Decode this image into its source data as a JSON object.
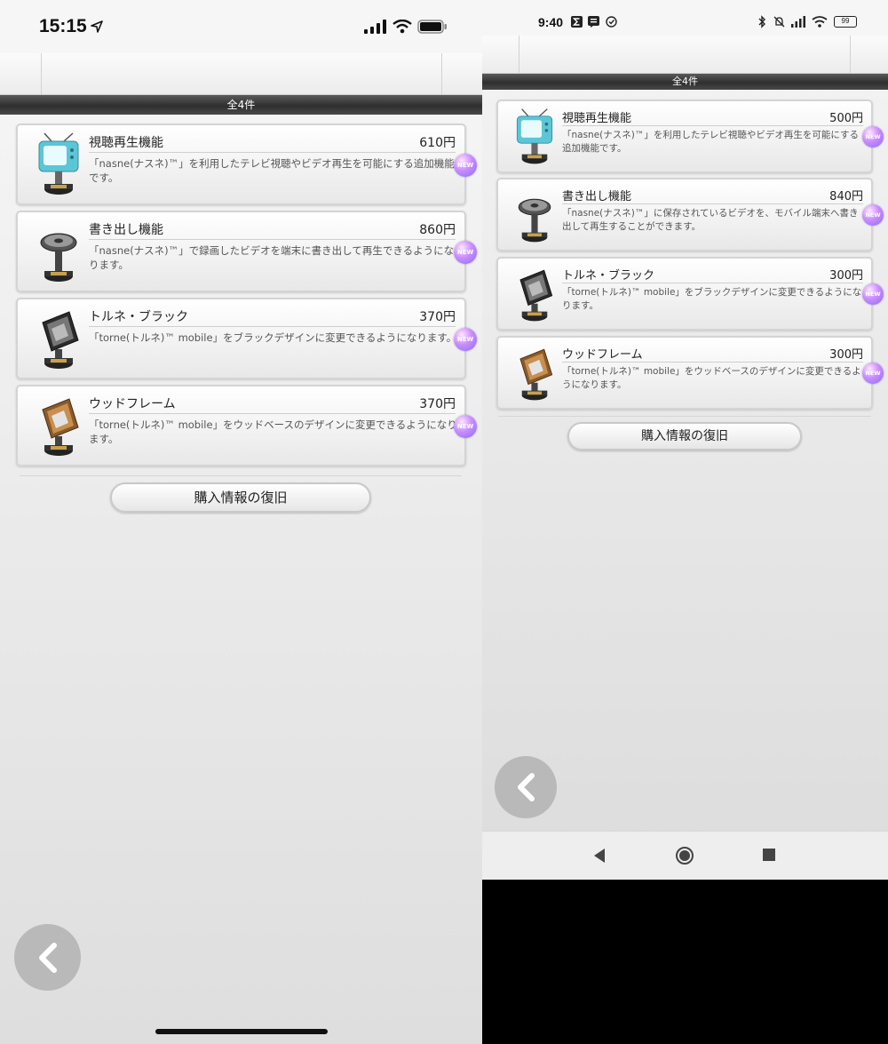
{
  "ios": {
    "status": {
      "time": "15:15"
    },
    "count_label": "全4件",
    "items": [
      {
        "title": "視聴再生機能",
        "price": "610円",
        "desc": "「nasne(ナスネ)™」を利用したテレビ視聴やビデオ再生を可能にする追加機能です。",
        "badge": "NEW",
        "thumb": "tv-trophy"
      },
      {
        "title": "書き出し機能",
        "price": "860円",
        "desc": "「nasne(ナスネ)™」で録画したビデオを端末に書き出して再生できるようになります。",
        "badge": "NEW",
        "thumb": "reel-trophy"
      },
      {
        "title": "トルネ・ブラック",
        "price": "370円",
        "desc": "「torne(トルネ)™ mobile」をブラックデザインに変更できるようになります。",
        "badge": "NEW",
        "thumb": "black-box-trophy"
      },
      {
        "title": "ウッドフレーム",
        "price": "370円",
        "desc": "「torne(トルネ)™ mobile」をウッドベースのデザインに変更できるようになります。",
        "badge": "NEW",
        "thumb": "wood-box-trophy"
      }
    ],
    "restore_label": "購入情報の復旧"
  },
  "android": {
    "status": {
      "time": "9:40",
      "battery": "99"
    },
    "count_label": "全4件",
    "items": [
      {
        "title": "視聴再生機能",
        "price": "500円",
        "desc": "「nasne(ナスネ)™」を利用したテレビ視聴やビデオ再生を可能にする追加機能です。",
        "badge": "NEW",
        "thumb": "tv-trophy"
      },
      {
        "title": "書き出し機能",
        "price": "840円",
        "desc": "「nasne(ナスネ)™」に保存されているビデオを、モバイル端末へ書き出して再生することができます。",
        "badge": "NEW",
        "thumb": "reel-trophy"
      },
      {
        "title": "トルネ・ブラック",
        "price": "300円",
        "desc": "「torne(トルネ)™ mobile」をブラックデザインに変更できるようになります。",
        "badge": "NEW",
        "thumb": "black-box-trophy"
      },
      {
        "title": "ウッドフレーム",
        "price": "300円",
        "desc": "「torne(トルネ)™ mobile」をウッドベースのデザインに変更できるようになります。",
        "badge": "NEW",
        "thumb": "wood-box-trophy"
      }
    ],
    "restore_label": "購入情報の復旧"
  },
  "icons": {
    "back": "chevron-left-icon",
    "nav_back": "triangle-back-icon",
    "nav_home": "circle-home-icon",
    "nav_recents": "square-recents-icon"
  },
  "colors": {
    "badge": "#b58cff",
    "tv": "#5bc6d6",
    "countbar": "#3a3a3a"
  }
}
